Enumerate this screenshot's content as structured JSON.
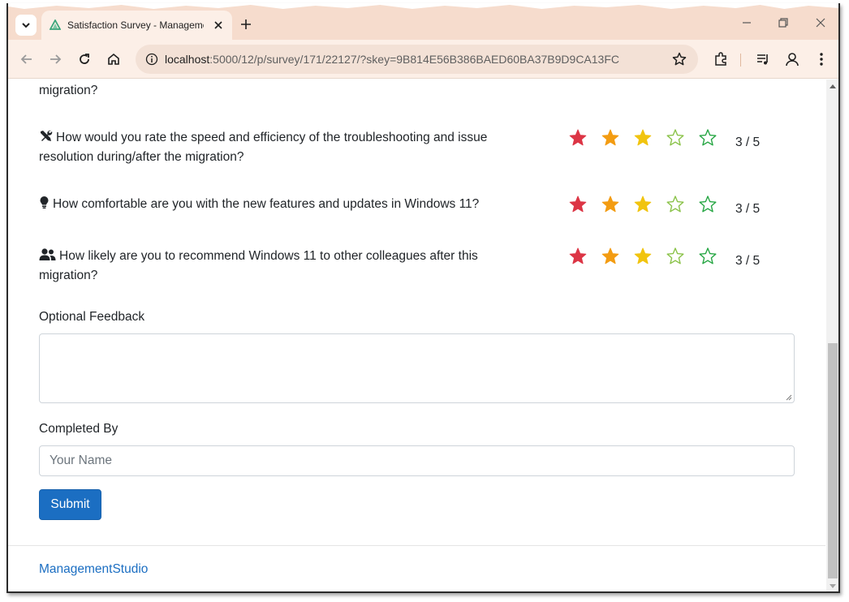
{
  "browser": {
    "tab_title": "Satisfaction Survey - ManagementStudio",
    "url_host": "localhost",
    "url_rest": ":5000/12/p/survey/171/22127/?skey=9B814E56B386BAED60BA37B9D9CA13FC"
  },
  "survey": {
    "questions": [
      {
        "icon": "partial-text",
        "text": "migration?",
        "rating": null,
        "score_text": ""
      },
      {
        "icon": "tools-icon",
        "text": "How would you rate the speed and efficiency of the troubleshooting and issue resolution during/after the migration?",
        "rating": 3,
        "max": 5,
        "score_text": "3 / 5"
      },
      {
        "icon": "lightbulb-icon",
        "text": "How comfortable are you with the new features and updates in Windows 11?",
        "rating": 3,
        "max": 5,
        "score_text": "3 / 5"
      },
      {
        "icon": "people-icon",
        "text": "How likely are you to recommend Windows 11 to other colleagues after this migration?",
        "rating": 3,
        "max": 5,
        "score_text": "3 / 5"
      }
    ],
    "star_colors": [
      "#dc3545",
      "#f39c12",
      "#f1c40f",
      "#8bc34a",
      "#28a745"
    ],
    "feedback_label": "Optional Feedback",
    "feedback_value": "",
    "completed_by_label": "Completed By",
    "name_placeholder": "Your Name",
    "name_value": "",
    "submit_label": "Submit"
  },
  "footer": {
    "link_text": "ManagementStudio"
  }
}
